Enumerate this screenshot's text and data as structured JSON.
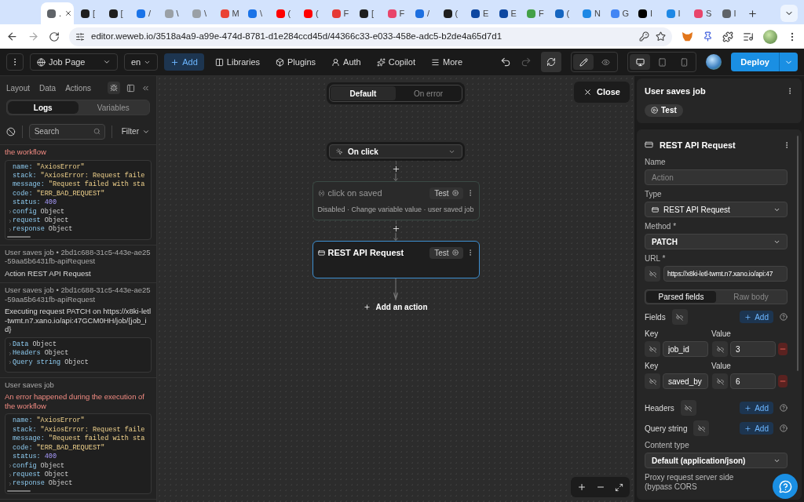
{
  "browser": {
    "tabs": [
      {
        "label": ".",
        "selected": true,
        "color": "#5f6368"
      },
      {
        "label": "[",
        "selected": false,
        "color": "#1f1f1f"
      },
      {
        "label": "[",
        "selected": false,
        "color": "#1f1f1f"
      },
      {
        "label": "/",
        "selected": false,
        "color": "#1a73e8"
      },
      {
        "label": "\\",
        "selected": false,
        "color": "#9aa0a6"
      },
      {
        "label": "\\",
        "selected": false,
        "color": "#9aa0a6"
      },
      {
        "label": "M",
        "selected": false,
        "color": "#ea4335"
      },
      {
        "label": "\\",
        "selected": false,
        "color": "#1a73e8"
      },
      {
        "label": "(",
        "selected": false,
        "color": "#ff0000"
      },
      {
        "label": "(",
        "selected": false,
        "color": "#ff0000"
      },
      {
        "label": "F",
        "selected": false,
        "color": "#e53935"
      },
      {
        "label": "[",
        "selected": false,
        "color": "#1f1f1f"
      },
      {
        "label": "F",
        "selected": false,
        "color": "#e8456b"
      },
      {
        "label": "/",
        "selected": false,
        "color": "#1d6fe0"
      },
      {
        "label": "(",
        "selected": false,
        "color": "#1f1f1f"
      },
      {
        "label": "E",
        "selected": false,
        "color": "#0d47a1"
      },
      {
        "label": "E",
        "selected": false,
        "color": "#0d47a1"
      },
      {
        "label": "F",
        "selected": false,
        "color": "#43a047"
      },
      {
        "label": "(",
        "selected": false,
        "color": "#1565c0"
      },
      {
        "label": "N",
        "selected": false,
        "color": "#1e88e5"
      },
      {
        "label": "G",
        "selected": false,
        "color": "#4285f4"
      },
      {
        "label": "I",
        "selected": false,
        "color": "#000000"
      },
      {
        "label": "I",
        "selected": false,
        "color": "#1e88e5"
      },
      {
        "label": "S",
        "selected": false,
        "color": "#e8456b"
      },
      {
        "label": "I",
        "selected": false,
        "color": "#5f6368"
      }
    ],
    "url": "editor.weweb.io/3518a4a9-a99e-474d-8781-d1e284ccd45d/44366c33-e033-458e-adc5-b2de4a65d7d1"
  },
  "toolbar": {
    "page": "Job Page",
    "lang": "en",
    "add": "Add",
    "items": [
      {
        "label": "Libraries",
        "kind": "libraries"
      },
      {
        "label": "Plugins",
        "kind": "plugins"
      },
      {
        "label": "Auth",
        "kind": "auth"
      },
      {
        "label": "Copilot",
        "kind": "copilot"
      },
      {
        "label": "More",
        "kind": "more"
      }
    ],
    "history": [
      {
        "kind": "undo",
        "disabled": false
      },
      {
        "kind": "redo",
        "disabled": true
      }
    ],
    "modes": [
      {
        "kind": "edit",
        "selected": true
      },
      {
        "kind": "preview",
        "selected": false
      }
    ],
    "devices": [
      {
        "kind": "desktop",
        "selected": true
      },
      {
        "kind": "tablet",
        "selected": false
      },
      {
        "kind": "mobile",
        "selected": false
      }
    ],
    "deploy": "Deploy"
  },
  "left_panel": {
    "tabs": [
      "Layout",
      "Data",
      "Actions"
    ],
    "segments": [
      {
        "label": "Logs",
        "selected": true
      },
      {
        "label": "Variables",
        "selected": false
      }
    ],
    "search": {
      "placeholder": "Search"
    },
    "filter": "Filter",
    "logs": [
      {
        "kind": "error",
        "error": "the workflow",
        "lines": [
          {
            "kind": "string",
            "key": "name:",
            "value": "\"AxiosError\""
          },
          {
            "kind": "string",
            "key": "stack:",
            "value": "\"AxiosError: Request faile"
          },
          {
            "kind": "string",
            "key": "message:",
            "value": "\"Request failed with sta"
          },
          {
            "kind": "string",
            "key": "code:",
            "value": "\"ERR_BAD_REQUEST\""
          },
          {
            "kind": "number",
            "key": "status:",
            "value": "400"
          },
          {
            "kind": "object",
            "key": "config",
            "value": "Object"
          },
          {
            "kind": "object",
            "key": "request",
            "value": "Object"
          },
          {
            "kind": "object",
            "key": "response",
            "value": "Object"
          }
        ]
      },
      {
        "kind": "info",
        "title": "User saves job • 2bd1c688-31c5-443e-ae25-59aa5b6431fb-apiRequest",
        "message": "Action REST API Request"
      },
      {
        "kind": "info",
        "title": "User saves job • 2bd1c688-31c5-443e-ae25-59aa5b6431fb-apiRequest",
        "message": "Executing request PATCH on https://x8ki-letl-twmt.n7.xano.io/api:47GCM0HH/job/{job_id}",
        "lines": [
          {
            "kind": "object",
            "key": "Data",
            "value": "Object"
          },
          {
            "kind": "object",
            "key": "Headers",
            "value": "Object"
          },
          {
            "kind": "object",
            "key": "Query string",
            "value": "Object"
          }
        ]
      },
      {
        "kind": "error",
        "title": "User saves job",
        "error": "An error happened during the execution of the workflow",
        "lines": [
          {
            "kind": "string",
            "key": "name:",
            "value": "\"AxiosError\""
          },
          {
            "kind": "string",
            "key": "stack:",
            "value": "\"AxiosError: Request faile"
          },
          {
            "kind": "string",
            "key": "message:",
            "value": "\"Request failed with sta"
          },
          {
            "kind": "string",
            "key": "code:",
            "value": "\"ERR_BAD_REQUEST\""
          },
          {
            "kind": "number",
            "key": "status:",
            "value": "400"
          },
          {
            "kind": "object",
            "key": "config",
            "value": "Object"
          },
          {
            "kind": "object",
            "key": "request",
            "value": "Object"
          },
          {
            "kind": "object",
            "key": "response",
            "value": "Object"
          }
        ]
      }
    ]
  },
  "workflow": {
    "branches": [
      {
        "label": "Default",
        "selected": true
      },
      {
        "label": "On error",
        "selected": false
      }
    ],
    "close": "Close",
    "trigger": "On click",
    "actions": [
      {
        "kind": "variable",
        "title": "click on saved",
        "subtitle": "Disabled · Change variable value · user saved job",
        "test": "Test",
        "disabled": true,
        "selected": false
      },
      {
        "kind": "rest",
        "title": "REST API Request",
        "test": "Test",
        "disabled": false,
        "selected": true
      }
    ],
    "add_action": "Add an action"
  },
  "inspector": {
    "workflow_title": "User saves job",
    "workflow_test": "Test",
    "action_title": "REST API Request",
    "name": {
      "label": "Name",
      "placeholder": "Action"
    },
    "type": {
      "label": "Type",
      "value": "REST API Request"
    },
    "method": {
      "label": "Method *",
      "value": "PATCH"
    },
    "url": {
      "label": "URL *",
      "value": "https://x8ki-letl-twmt.n7.xano.io/api:47"
    },
    "body_tabs": [
      {
        "label": "Parsed fields",
        "selected": true
      },
      {
        "label": "Raw body",
        "selected": false
      }
    ],
    "fields": {
      "label": "Fields",
      "add": "Add",
      "rows": [
        {
          "key_label": "Key",
          "value_label": "Value",
          "key": "job_id",
          "value": "3"
        },
        {
          "key_label": "Key",
          "value_label": "Value",
          "key": "saved_by",
          "value": "6"
        }
      ]
    },
    "headers": {
      "label": "Headers",
      "add": "Add"
    },
    "query": {
      "label": "Query string",
      "add": "Add"
    },
    "content_type": {
      "label": "Content type",
      "value": "Default (application/json)"
    },
    "proxy": "Proxy request server side (bypass CORS"
  }
}
